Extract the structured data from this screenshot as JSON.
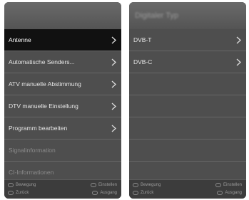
{
  "left_screen": {
    "header": "",
    "items": [
      {
        "label": "Antenne",
        "has_submenu": true,
        "selected": true,
        "enabled": true
      },
      {
        "label": "Automatische Senders...",
        "has_submenu": true,
        "selected": false,
        "enabled": true
      },
      {
        "label": "ATV manuelle Abstimmung",
        "has_submenu": true,
        "selected": false,
        "enabled": true
      },
      {
        "label": "DTV manuelle Einstellung",
        "has_submenu": true,
        "selected": false,
        "enabled": true
      },
      {
        "label": "Programm bearbeiten",
        "has_submenu": true,
        "selected": false,
        "enabled": true
      },
      {
        "label": "Signalinformation",
        "has_submenu": false,
        "selected": false,
        "enabled": false
      },
      {
        "label": "CI-Informationen",
        "has_submenu": false,
        "selected": false,
        "enabled": false
      }
    ],
    "footer": {
      "move": "Bewegung",
      "back": "Zurück",
      "set": "Einstellen",
      "exit": "Ausgang"
    }
  },
  "right_screen": {
    "header": "Digitaler Typ",
    "items": [
      {
        "label": "DVB-T",
        "has_submenu": true,
        "selected": false,
        "enabled": true
      },
      {
        "label": "DVB-C",
        "has_submenu": true,
        "selected": false,
        "enabled": true
      },
      {
        "label": "",
        "has_submenu": false,
        "selected": false,
        "enabled": true
      },
      {
        "label": "",
        "has_submenu": false,
        "selected": false,
        "enabled": true
      },
      {
        "label": "",
        "has_submenu": false,
        "selected": false,
        "enabled": true
      },
      {
        "label": "",
        "has_submenu": false,
        "selected": false,
        "enabled": true
      },
      {
        "label": "",
        "has_submenu": false,
        "selected": false,
        "enabled": true
      }
    ],
    "footer": {
      "move": "Bewegung",
      "back": "Zurück",
      "set": "Einstellen",
      "exit": "Ausgang"
    }
  },
  "colors": {
    "selected_bg": "#111111",
    "item_bg": "#4e4e4e",
    "disabled_text": "#8a8a8a",
    "text": "#e6e6e6"
  },
  "icons": {
    "submenu": "chevron-right-icon",
    "hint": "remote-button-icon"
  }
}
